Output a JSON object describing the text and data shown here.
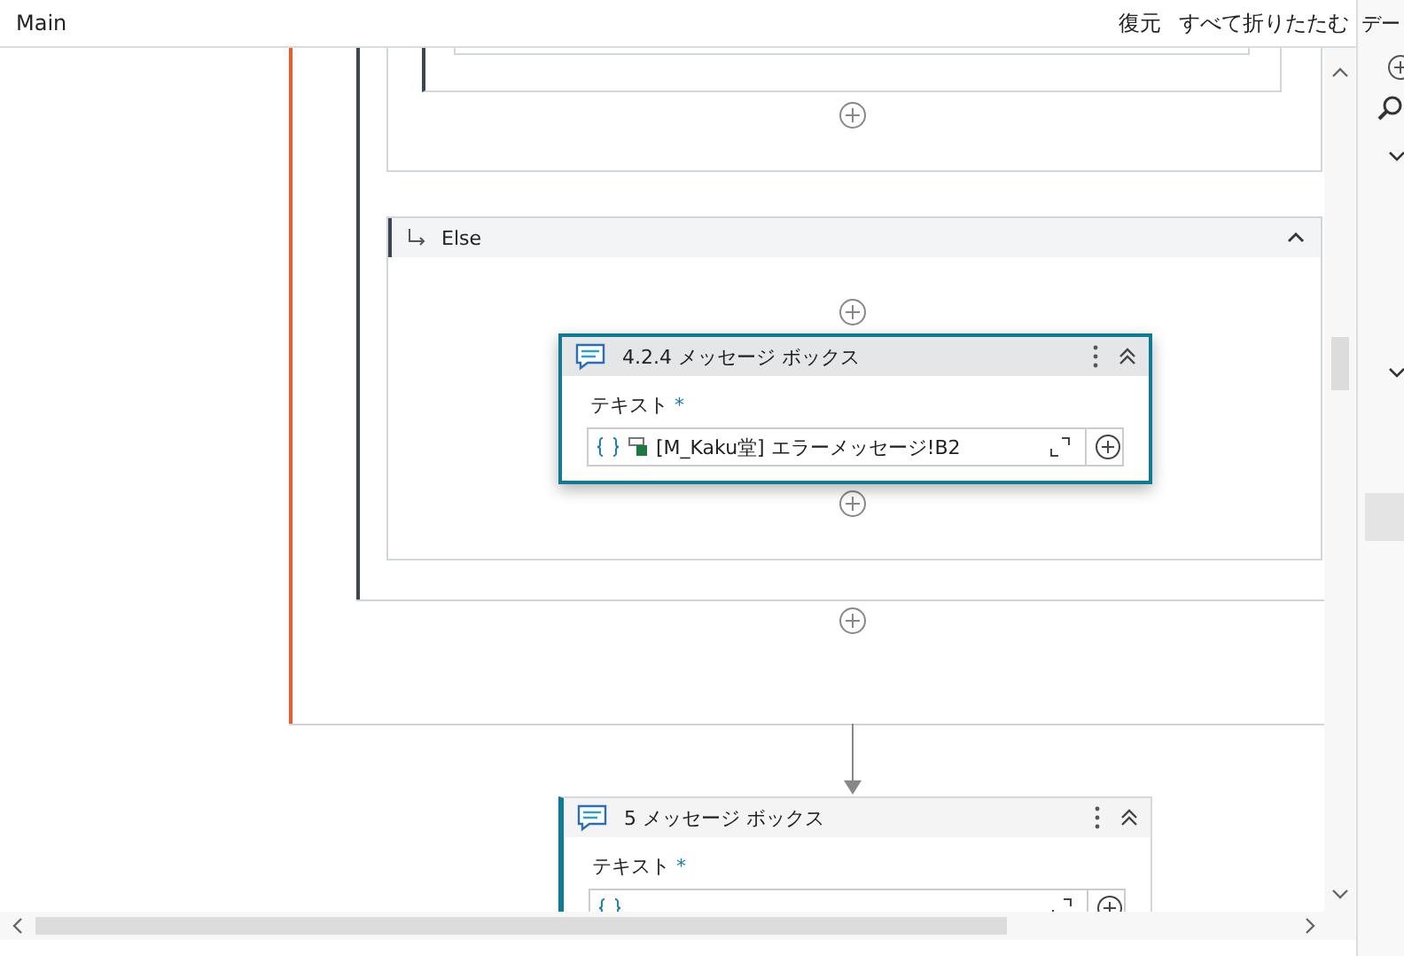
{
  "header": {
    "title": "Main",
    "actions": [
      "復元",
      "すべて折りたたむ"
    ]
  },
  "canvas": {
    "else_branch": {
      "label": "Else",
      "expanded": true
    },
    "activities": [
      {
        "title": "4.2.4 メッセージ ボックス",
        "selected": true,
        "field_label": "テキスト",
        "required_mark": "*",
        "value": "[M_Kaku堂] エラーメッセージ!B2"
      },
      {
        "title": "5 メッセージ ボックス",
        "selected": false,
        "field_label": "テキスト",
        "required_mark": "*"
      }
    ]
  },
  "side_panel": {
    "title": "デー"
  }
}
